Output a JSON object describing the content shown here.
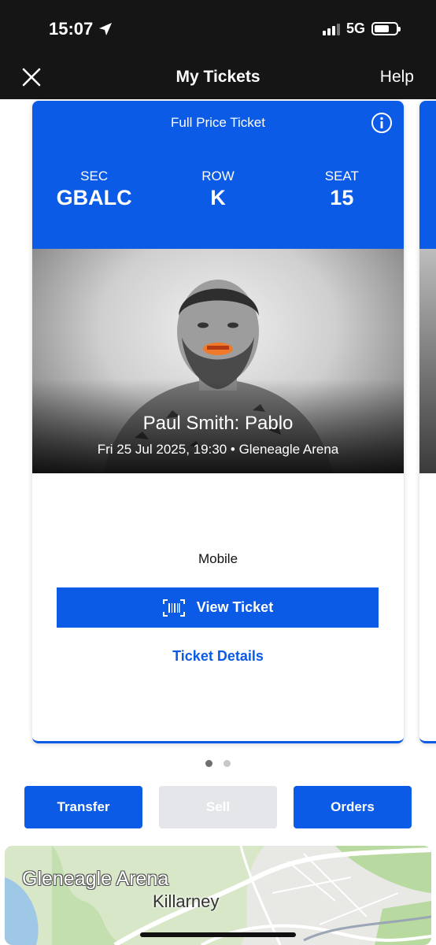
{
  "status_bar": {
    "time": "15:07",
    "network": "5G"
  },
  "nav": {
    "title": "My Tickets",
    "help": "Help"
  },
  "ticket": {
    "type": "Full Price Ticket",
    "section_label": "SEC",
    "section": "GBALC",
    "row_label": "ROW",
    "row": "K",
    "seat_label": "SEAT",
    "seat": "15",
    "event_name": "Paul Smith: Pablo",
    "event_meta": "Fri 25 Jul 2025, 19:30 • Gleneagle Arena",
    "delivery": "Mobile",
    "view_ticket": "View Ticket",
    "ticket_details": "Ticket Details"
  },
  "pager": {
    "count": 2,
    "active": 0
  },
  "actions": {
    "transfer": "Transfer",
    "sell": "Sell",
    "orders": "Orders"
  },
  "map": {
    "venue": "Gleneagle Arena",
    "town": "Killarney"
  },
  "colors": {
    "brand_blue": "#0b5be6",
    "header_dark": "#151515",
    "disabled": "#e4e6e9"
  }
}
